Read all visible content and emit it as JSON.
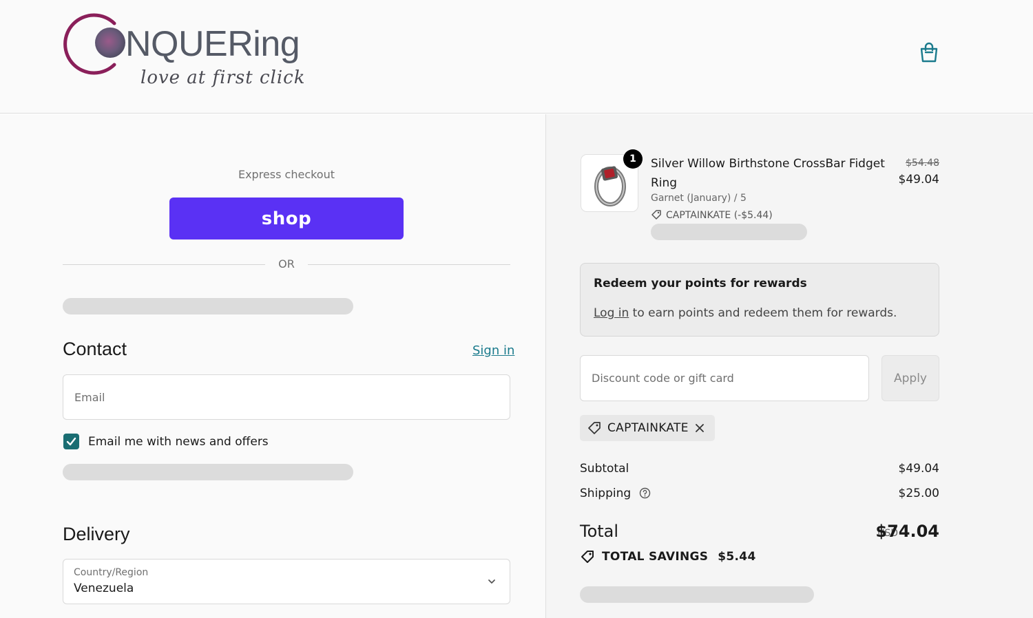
{
  "header": {
    "logo": {
      "wordmark": "NQUERing",
      "tagline": "love at first click"
    },
    "cart_icon": "shopping-bag-icon"
  },
  "express": {
    "label": "Express checkout",
    "shop_button_label": "shop",
    "or_label": "OR"
  },
  "contact": {
    "title": "Contact",
    "signin_label": "Sign in",
    "email_placeholder": "Email",
    "email_value": "",
    "newsletter_label": "Email me with news and offers",
    "newsletter_checked": true
  },
  "delivery": {
    "title": "Delivery",
    "country_label": "Country/Region",
    "country_value": "Venezuela"
  },
  "order": {
    "item": {
      "quantity": "1",
      "name": "Silver Willow Birthstone CrossBar Fidget Ring",
      "variant": "Garnet (January) / 5",
      "discount": "CAPTAINKATE (-$5.44)",
      "original_price": "$54.48",
      "price": "$49.04"
    },
    "rewards": {
      "title": "Redeem your points for rewards",
      "login_link": "Log in",
      "message": " to earn points and redeem them for rewards."
    },
    "discount": {
      "placeholder": "Discount code or gift card",
      "value": "",
      "apply_label": "Apply",
      "applied_code": "CAPTAINKATE"
    },
    "summary": {
      "subtotal_label": "Subtotal",
      "subtotal_value": "$49.04",
      "shipping_label": "Shipping",
      "shipping_value": "$25.00",
      "total_label": "Total",
      "currency": "USD",
      "total_value": "$74.04",
      "savings_label": "TOTAL SAVINGS",
      "savings_value": "$5.44"
    }
  },
  "colors": {
    "shop_purple": "#5a31f4",
    "link_teal": "#1a7a8c",
    "checkbox_teal": "#1a6e73",
    "logo_magenta": "#8a1f5a"
  }
}
